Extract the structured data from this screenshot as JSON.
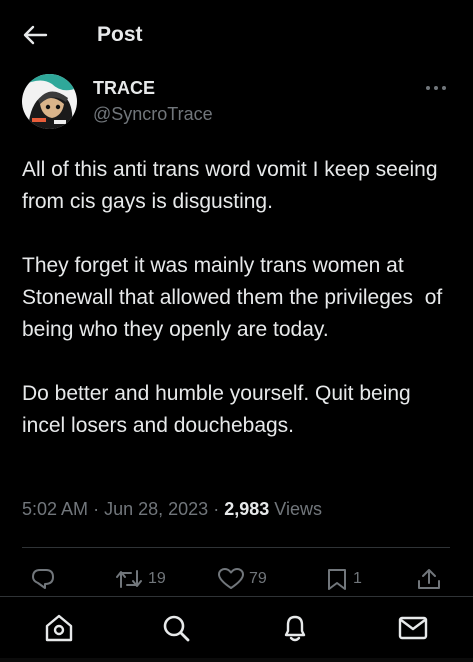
{
  "header": {
    "back_icon": "arrow-left-icon",
    "title": "Post"
  },
  "author": {
    "display_name": "TRACE",
    "handle": "@SyncroTrace",
    "more_icon": "more-horizontal-icon"
  },
  "post": {
    "paragraphs": [
      "All of this anti trans word vomit I keep seeing from cis gays is disgusting.",
      "They forget it was mainly trans women at Stonewall that allowed them the privileges  of being who they openly are today.",
      "Do better and humble yourself. Quit being incel losers and douchebags."
    ],
    "time": "5:02 AM",
    "separator": "·",
    "date": "Jun 28, 2023",
    "views_count": "2,983",
    "views_label": "Views"
  },
  "actions": {
    "reply": {
      "icon": "reply-icon",
      "count": ""
    },
    "repost": {
      "icon": "repost-icon",
      "count": "19"
    },
    "like": {
      "icon": "heart-icon",
      "count": "79"
    },
    "bookmark": {
      "icon": "bookmark-icon",
      "count": "1"
    },
    "share": {
      "icon": "share-icon",
      "count": ""
    }
  },
  "bottom_nav": {
    "items": [
      "home-icon",
      "search-icon",
      "notifications-icon",
      "messages-icon"
    ]
  },
  "colors": {
    "background": "#000000",
    "text_primary": "#e7e9ea",
    "text_secondary": "#71767b",
    "divider": "#2f3336"
  }
}
